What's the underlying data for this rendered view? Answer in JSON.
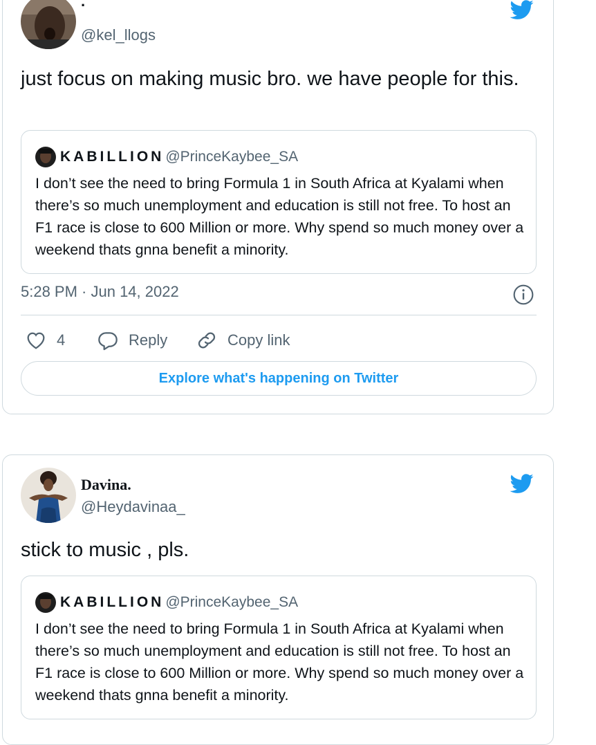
{
  "tweets": [
    {
      "author": {
        "display_name": ".",
        "handle": "@kel_llogs",
        "avatar_icon": "avatar-photo-man"
      },
      "text": "just focus on making music bro. we have people for this.",
      "quote": {
        "display_name": "KABILLION",
        "handle": "@PrinceKaybee_SA",
        "text": "I don’t see the need to bring Formula 1 in South Africa at Kyalami when there’s so much unemployment and education is still not free. To host an F1 race is close to 600 Million or more. Why spend so much money over a weekend thats gnna benefit a minority."
      },
      "timestamp": "5:28 PM · Jun 14, 2022",
      "actions": {
        "like_count": "4",
        "reply_label": "Reply",
        "copy_link_label": "Copy link"
      },
      "explore_label": "Explore what's happening on Twitter"
    },
    {
      "author": {
        "display_name": "Davina.",
        "handle": "@Heydavinaa_",
        "avatar_icon": "avatar-photo-woman"
      },
      "text": "stick to music , pls.",
      "quote": {
        "display_name": "KABILLION",
        "handle": "@PrinceKaybee_SA",
        "text": "I don’t see the need to bring Formula 1 in South Africa at Kyalami when there’s so much unemployment and education is still not free. To host an F1 race is close to 600 Million or more. Why spend so much money over a weekend thats gnna benefit a minority."
      }
    }
  ],
  "colors": {
    "twitter_blue": "#1d9bf0",
    "secondary_text": "#536471",
    "border": "#cfd9de",
    "primary_text": "#0f1419"
  }
}
